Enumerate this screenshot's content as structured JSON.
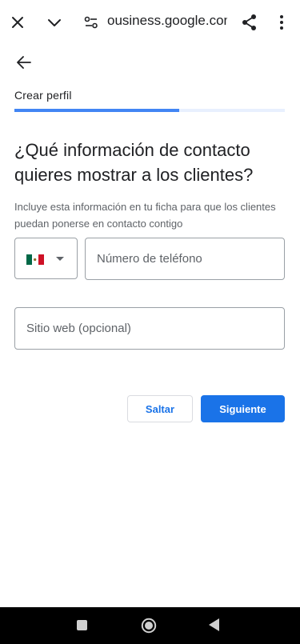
{
  "browser": {
    "url": "business.google.com",
    "url_visible": "ousiness.google.com"
  },
  "step": {
    "label": "Crear perfil",
    "progress": 0.61
  },
  "content": {
    "heading": "¿Qué información de contacto quieres mostrar a los clientes?",
    "description": "Incluye esta información en tu ficha para que los clientes puedan ponerse en contacto contigo"
  },
  "phone": {
    "country_flag": "mexico-flag",
    "placeholder": "Número de teléfono",
    "value": ""
  },
  "website": {
    "placeholder": "Sitio web (opcional)",
    "value": ""
  },
  "actions": {
    "skip_label": "Saltar",
    "next_label": "Siguiente"
  },
  "colors": {
    "accent": "#1a73e8",
    "progress": "#4285f4",
    "progress_track": "#e8f0fe",
    "flag_green": "#006847",
    "flag_white": "#ffffff",
    "flag_red": "#ce1126"
  },
  "icons": {
    "close": "close-icon",
    "dropdown": "chevron-down-icon",
    "site_settings": "site-settings-icon",
    "share": "share-icon",
    "menu": "more-vert-icon",
    "back": "arrow-back-icon"
  }
}
